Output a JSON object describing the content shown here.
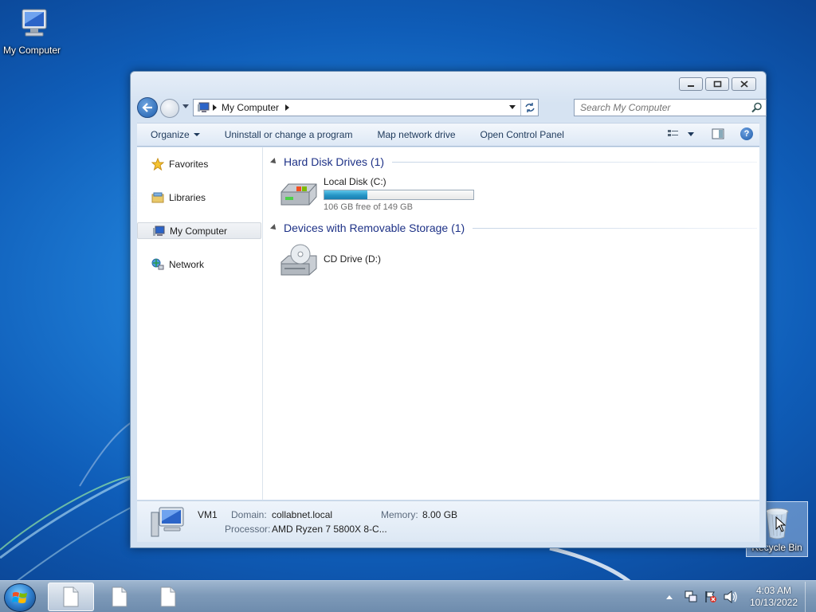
{
  "desktop": {
    "icons": [
      {
        "label": "My Computer",
        "icon": "computer-icon"
      },
      {
        "label": "Recycle Bin",
        "icon": "recycle-bin-icon"
      }
    ]
  },
  "window": {
    "address": {
      "crumb": "My Computer"
    },
    "search": {
      "placeholder": "Search My Computer"
    },
    "toolbar": {
      "organize": "Organize",
      "uninstall": "Uninstall or change a program",
      "map_drive": "Map network drive",
      "control_panel": "Open Control Panel"
    },
    "nav": {
      "favorites": "Favorites",
      "libraries": "Libraries",
      "my_computer": "My Computer",
      "network": "Network"
    },
    "groups": {
      "hdd": "Hard Disk Drives (1)",
      "removable": "Devices with Removable Storage (1)"
    },
    "drives": {
      "c": {
        "name": "Local Disk (C:)",
        "free": "106 GB free of 149 GB",
        "used_fraction": 0.29
      },
      "d": {
        "name": "CD Drive (D:)"
      }
    },
    "details": {
      "name": "VM1",
      "domain_label": "Domain:",
      "domain": "collabnet.local",
      "memory_label": "Memory:",
      "memory": "8.00 GB",
      "processor_label": "Processor:",
      "processor": "AMD Ryzen 7 5800X 8-C..."
    }
  },
  "taskbar": {
    "clock": {
      "time": "4:03 AM",
      "date": "10/13/2022"
    }
  }
}
